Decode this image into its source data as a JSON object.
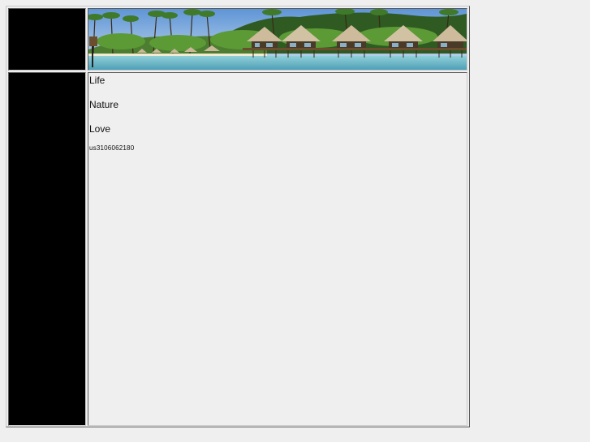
{
  "nav": {
    "items": [
      {
        "label": "Life"
      },
      {
        "label": "Nature"
      },
      {
        "label": "Love"
      }
    ]
  },
  "footer_id": "us3106062180",
  "banner": {
    "sky_color": "#8fb8e0",
    "water_color": "#6fb3c8",
    "foliage_color": "#3f6e2c",
    "roof_color": "#c9b79a"
  }
}
